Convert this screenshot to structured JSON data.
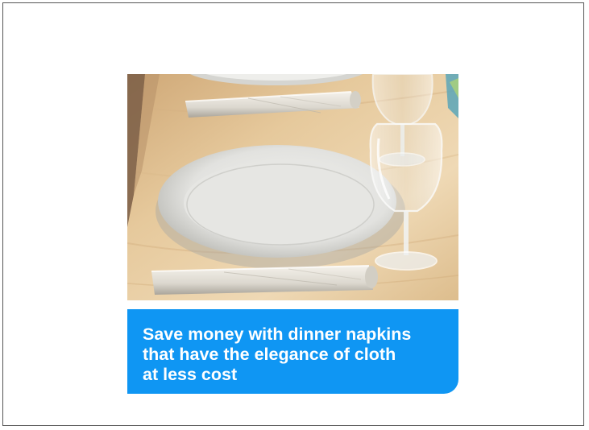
{
  "promo": {
    "image_subject": "place setting with white plate, rolled napkins and wine glasses",
    "caption": "Save money with dinner napkins\nthat have the elegance of cloth\nat less cost",
    "colors": {
      "caption_background": "#0f96f3",
      "caption_text": "#ffffff",
      "table_wood": "#e4c698",
      "frame_border": "#555555"
    }
  }
}
